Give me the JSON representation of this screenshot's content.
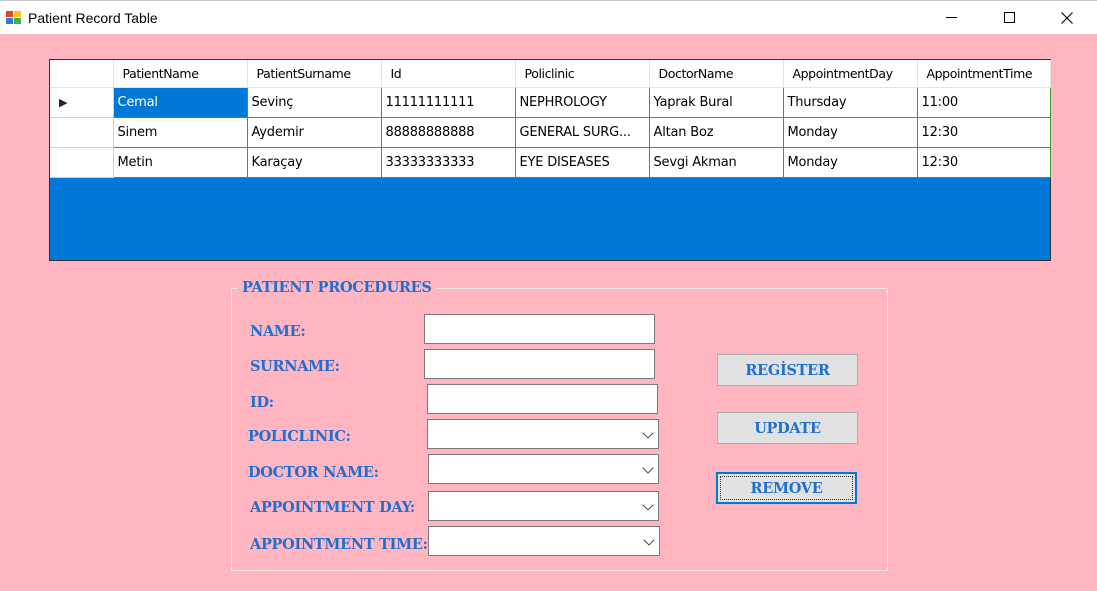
{
  "window": {
    "title": "Patient Record Table"
  },
  "grid": {
    "columns": [
      "PatientName",
      "PatientSurname",
      "Id",
      "Policlinic",
      "DoctorName",
      "AppointmentDay",
      "AppointmentTime"
    ],
    "rows": [
      {
        "indicator": "▶",
        "cells": [
          "Cemal",
          "Sevinç",
          "11111111111",
          "NEPHROLOGY",
          "Yaprak Bural",
          "Thursday",
          "11:00"
        ]
      },
      {
        "indicator": "",
        "cells": [
          "Sinem",
          "Aydemir",
          "88888888888",
          "GENERAL SURG...",
          "Altan Boz",
          "Monday",
          "12:30"
        ]
      },
      {
        "indicator": "",
        "cells": [
          "Metin",
          "Karaçay",
          "33333333333",
          "EYE DISEASES",
          "Sevgi Akman",
          "Monday",
          "12:30"
        ]
      }
    ]
  },
  "form": {
    "group_title": "PATIENT PROCEDURES",
    "labels": {
      "name": "NAME:",
      "surname": "SURNAME:",
      "id": "ID:",
      "policlinic": "POLICLINIC:",
      "doctor_name": "DOCTOR NAME:",
      "appointment_day": "APPOINTMENT DAY:",
      "appointment_time": "APPOINTMENT TIME:"
    },
    "values": {
      "name": "",
      "surname": "",
      "id": "",
      "policlinic": "",
      "doctor_name": "",
      "appointment_day": "",
      "appointment_time": ""
    },
    "buttons": {
      "register": "REGİSTER",
      "update": "UPDATE",
      "remove": "REMOVE"
    }
  },
  "colors": {
    "background": "#ffb6c1",
    "label_text": "#1f6fd1",
    "selection": "#0078d7",
    "grid_lines": "#3a9b3a"
  }
}
